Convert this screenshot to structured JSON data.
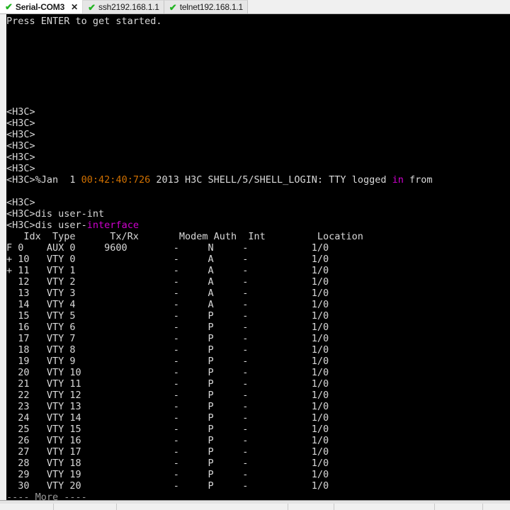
{
  "tabs": [
    {
      "label": "Serial-COM3",
      "status_icon": "check-icon",
      "active": true,
      "close_icon": "✕"
    },
    {
      "label": "ssh2192.168.1.1",
      "status_icon": "check-icon",
      "active": false
    },
    {
      "label": "telnet192.168.1.1",
      "status_icon": "check-icon",
      "active": false
    }
  ],
  "colors": {
    "check_green": "#22b422",
    "terminal_bg": "#000000",
    "terminal_fg": "#d9d9d9",
    "timestamp_orange": "#d07000",
    "keyword_magenta": "#d000d0"
  },
  "terminal": {
    "intro_line": "Press ENTER to get started.",
    "prompt": "<H3C>",
    "blank_prompts_count": 6,
    "log": {
      "prefix": "<H3C>%Jan  1 ",
      "timestamp": "00:42:40:726",
      "middle": " 2013 H3C SHELL/5/SHELL_LOGIN: TTY logged ",
      "keyword": "in",
      "suffix": " from"
    },
    "command_1": "<H3C>dis user-int",
    "command_2_prefix": "<H3C>dis user-",
    "command_2_completion": "interface",
    "more_prompt": "---- More ----",
    "table": {
      "headers": [
        "Idx",
        "Type",
        "Tx/Rx",
        "Modem",
        "Auth",
        "Int",
        "Location"
      ],
      "header_line": "   Idx  Type      Tx/Rx       Modem Auth  Int         Location",
      "rows": [
        {
          "flag": "F",
          "idx": "0",
          "type": "AUX 0",
          "txrx": "9600",
          "modem": "-",
          "auth": "N",
          "int": "-",
          "location": "1/0"
        },
        {
          "flag": "+",
          "idx": "10",
          "type": "VTY 0",
          "txrx": "",
          "modem": "-",
          "auth": "A",
          "int": "-",
          "location": "1/0"
        },
        {
          "flag": "+",
          "idx": "11",
          "type": "VTY 1",
          "txrx": "",
          "modem": "-",
          "auth": "A",
          "int": "-",
          "location": "1/0"
        },
        {
          "flag": " ",
          "idx": "12",
          "type": "VTY 2",
          "txrx": "",
          "modem": "-",
          "auth": "A",
          "int": "-",
          "location": "1/0"
        },
        {
          "flag": " ",
          "idx": "13",
          "type": "VTY 3",
          "txrx": "",
          "modem": "-",
          "auth": "A",
          "int": "-",
          "location": "1/0"
        },
        {
          "flag": " ",
          "idx": "14",
          "type": "VTY 4",
          "txrx": "",
          "modem": "-",
          "auth": "A",
          "int": "-",
          "location": "1/0"
        },
        {
          "flag": " ",
          "idx": "15",
          "type": "VTY 5",
          "txrx": "",
          "modem": "-",
          "auth": "P",
          "int": "-",
          "location": "1/0"
        },
        {
          "flag": " ",
          "idx": "16",
          "type": "VTY 6",
          "txrx": "",
          "modem": "-",
          "auth": "P",
          "int": "-",
          "location": "1/0"
        },
        {
          "flag": " ",
          "idx": "17",
          "type": "VTY 7",
          "txrx": "",
          "modem": "-",
          "auth": "P",
          "int": "-",
          "location": "1/0"
        },
        {
          "flag": " ",
          "idx": "18",
          "type": "VTY 8",
          "txrx": "",
          "modem": "-",
          "auth": "P",
          "int": "-",
          "location": "1/0"
        },
        {
          "flag": " ",
          "idx": "19",
          "type": "VTY 9",
          "txrx": "",
          "modem": "-",
          "auth": "P",
          "int": "-",
          "location": "1/0"
        },
        {
          "flag": " ",
          "idx": "20",
          "type": "VTY 10",
          "txrx": "",
          "modem": "-",
          "auth": "P",
          "int": "-",
          "location": "1/0"
        },
        {
          "flag": " ",
          "idx": "21",
          "type": "VTY 11",
          "txrx": "",
          "modem": "-",
          "auth": "P",
          "int": "-",
          "location": "1/0"
        },
        {
          "flag": " ",
          "idx": "22",
          "type": "VTY 12",
          "txrx": "",
          "modem": "-",
          "auth": "P",
          "int": "-",
          "location": "1/0"
        },
        {
          "flag": " ",
          "idx": "23",
          "type": "VTY 13",
          "txrx": "",
          "modem": "-",
          "auth": "P",
          "int": "-",
          "location": "1/0"
        },
        {
          "flag": " ",
          "idx": "24",
          "type": "VTY 14",
          "txrx": "",
          "modem": "-",
          "auth": "P",
          "int": "-",
          "location": "1/0"
        },
        {
          "flag": " ",
          "idx": "25",
          "type": "VTY 15",
          "txrx": "",
          "modem": "-",
          "auth": "P",
          "int": "-",
          "location": "1/0"
        },
        {
          "flag": " ",
          "idx": "26",
          "type": "VTY 16",
          "txrx": "",
          "modem": "-",
          "auth": "P",
          "int": "-",
          "location": "1/0"
        },
        {
          "flag": " ",
          "idx": "27",
          "type": "VTY 17",
          "txrx": "",
          "modem": "-",
          "auth": "P",
          "int": "-",
          "location": "1/0"
        },
        {
          "flag": " ",
          "idx": "28",
          "type": "VTY 18",
          "txrx": "",
          "modem": "-",
          "auth": "P",
          "int": "-",
          "location": "1/0"
        },
        {
          "flag": " ",
          "idx": "29",
          "type": "VTY 19",
          "txrx": "",
          "modem": "-",
          "auth": "P",
          "int": "-",
          "location": "1/0"
        },
        {
          "flag": " ",
          "idx": "30",
          "type": "VTY 20",
          "txrx": "",
          "modem": "-",
          "auth": "P",
          "int": "-",
          "location": "1/0"
        }
      ]
    }
  }
}
